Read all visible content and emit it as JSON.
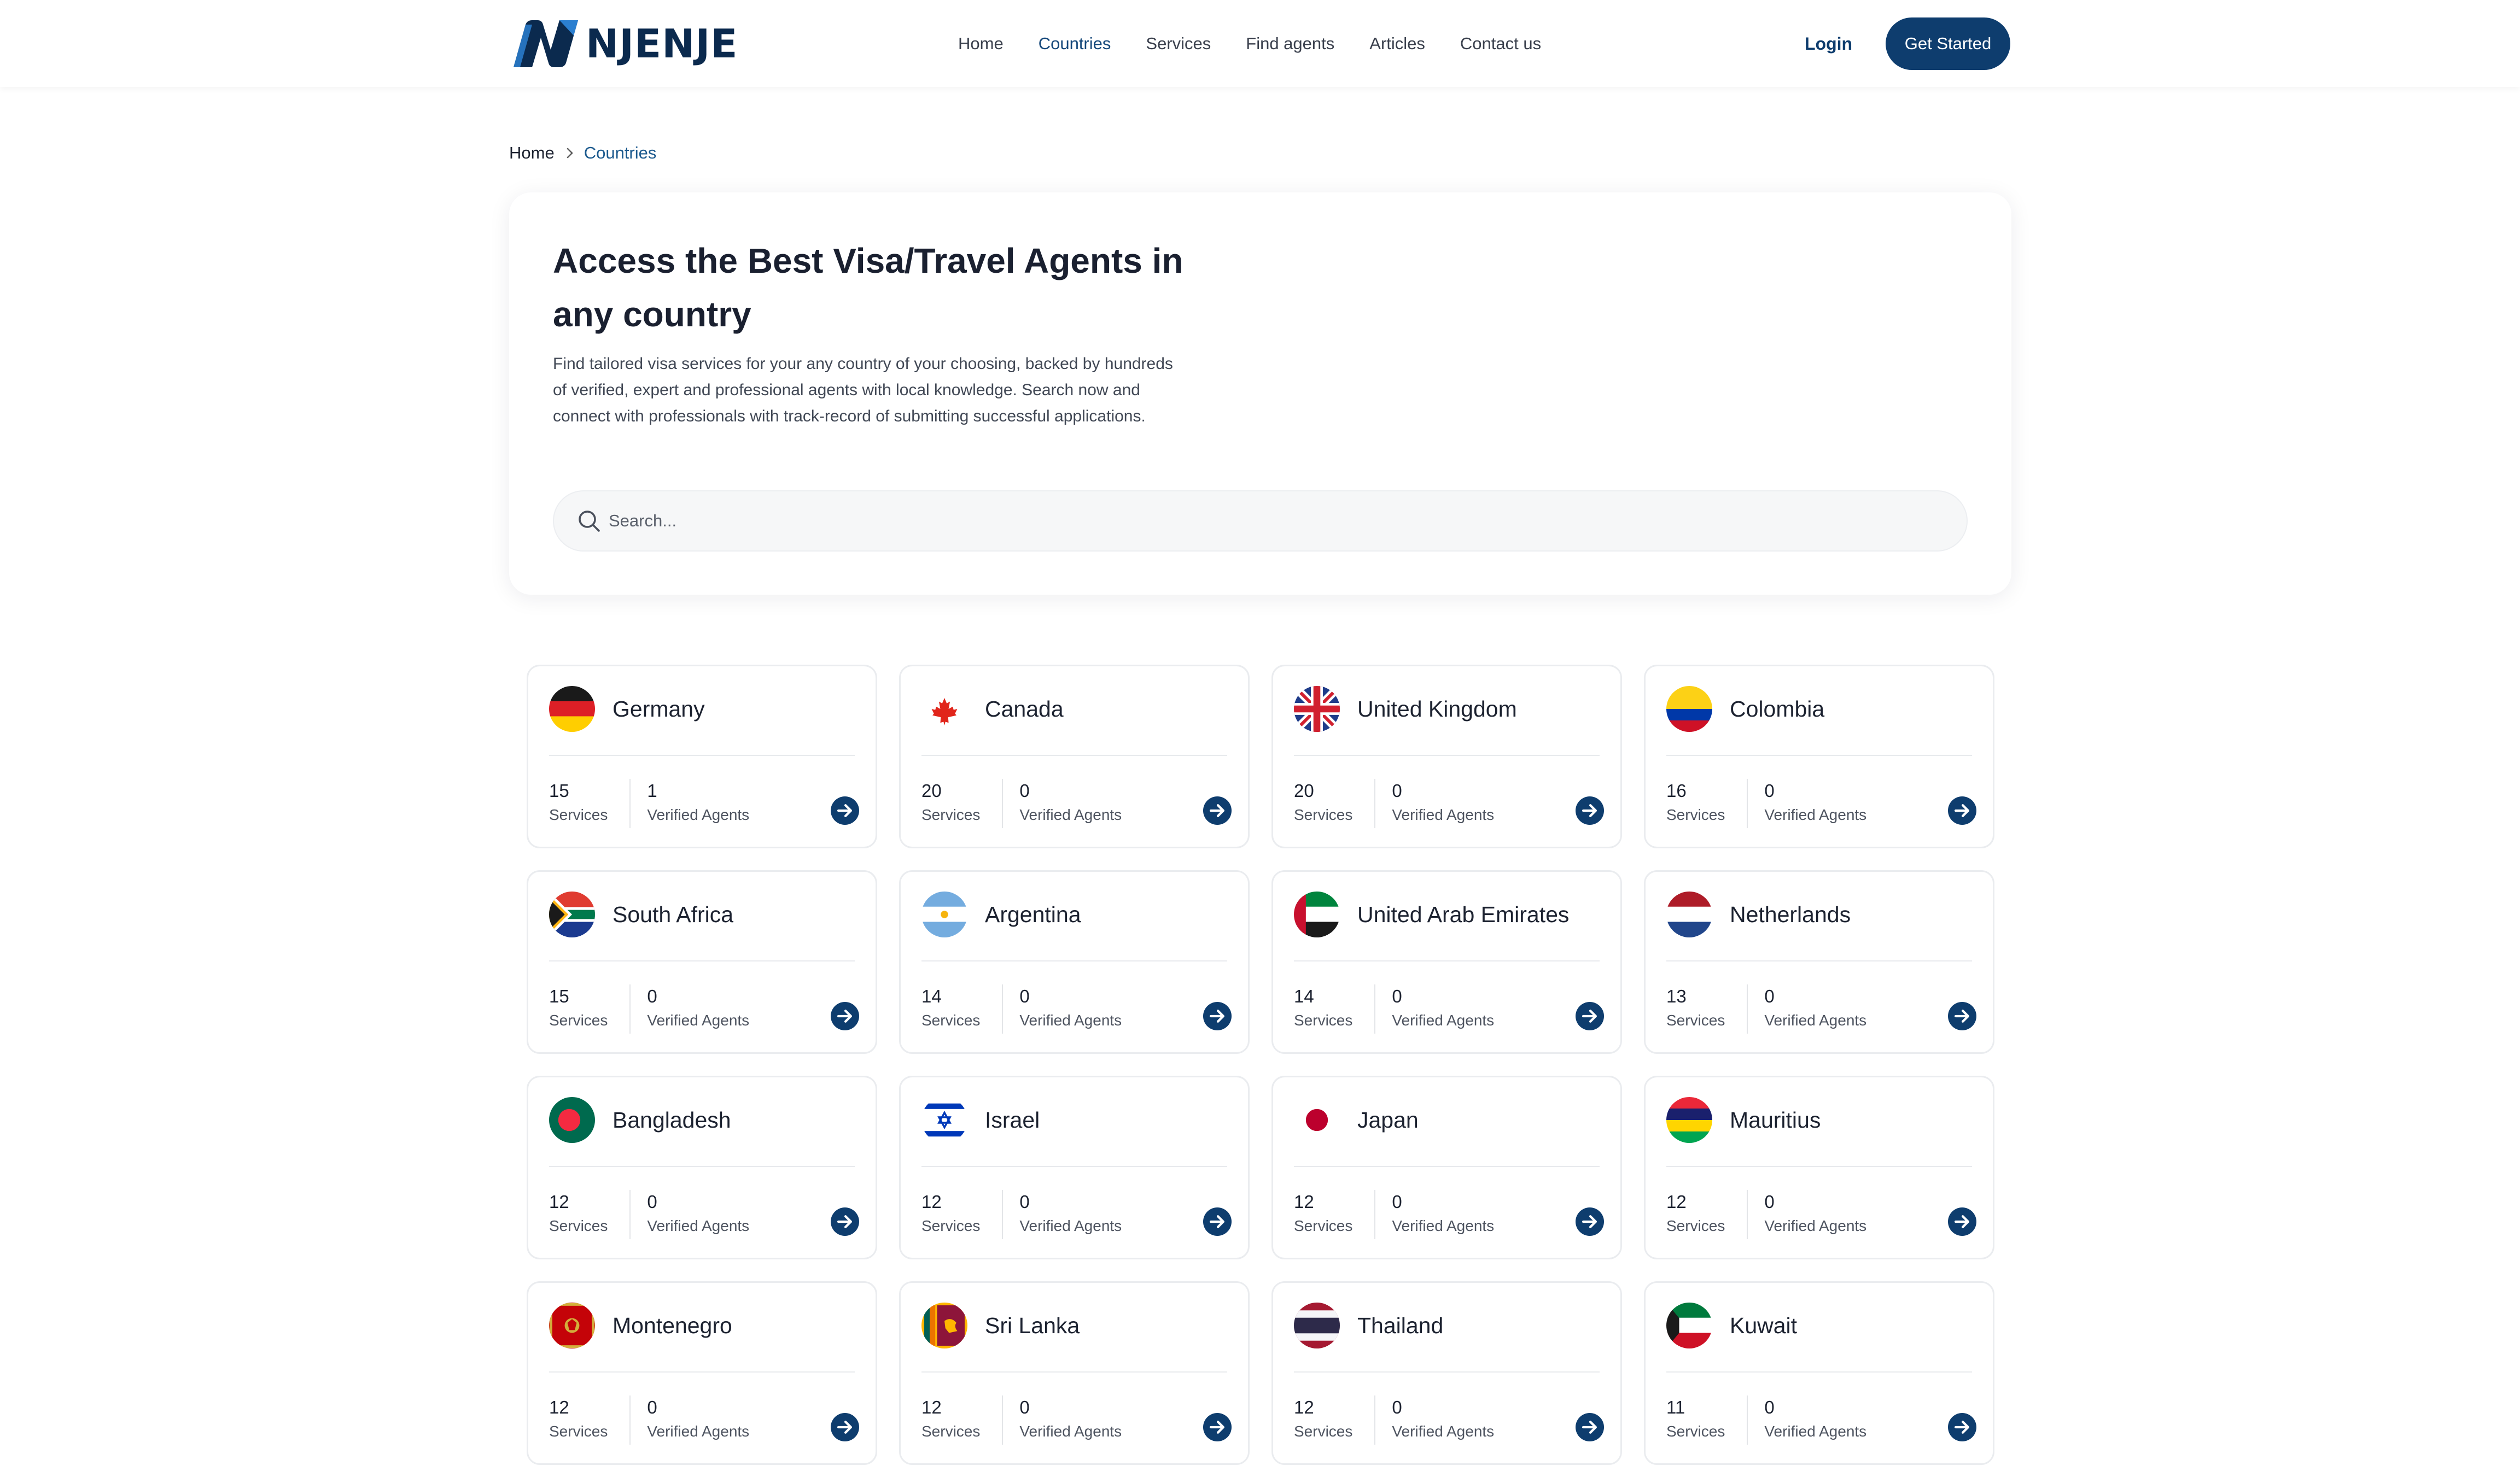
{
  "brand": {
    "name": "NJENJE"
  },
  "nav": {
    "links": [
      "Home",
      "Countries",
      "Services",
      "Find agents",
      "Articles",
      "Contact us"
    ],
    "active": "Countries",
    "login": "Login",
    "cta": "Get Started"
  },
  "breadcrumb": {
    "home": "Home",
    "current": "Countries"
  },
  "hero": {
    "title": "Access the Best Visa/Travel Agents in any country",
    "description": "Find tailored visa services for your any country of your choosing, backed by hundreds of verified, expert and professional agents with local knowledge. Search now and connect with professionals with track-record of submitting successful applications.",
    "search_placeholder": "Search..."
  },
  "labels": {
    "services": "Services",
    "agents": "Verified Agents"
  },
  "colors": {
    "primary": "#0e3d6e",
    "link_active": "#14477a",
    "text": "#1c2230"
  },
  "countries": [
    {
      "name": "Germany",
      "services": "15",
      "agents": "1",
      "flag": "germany-flag-icon"
    },
    {
      "name": "Canada",
      "services": "20",
      "agents": "0",
      "flag": "canada-flag-icon"
    },
    {
      "name": "United Kingdom",
      "services": "20",
      "agents": "0",
      "flag": "uk-flag-icon"
    },
    {
      "name": "Colombia",
      "services": "16",
      "agents": "0",
      "flag": "colombia-flag-icon"
    },
    {
      "name": "South Africa",
      "services": "15",
      "agents": "0",
      "flag": "south-africa-flag-icon"
    },
    {
      "name": "Argentina",
      "services": "14",
      "agents": "0",
      "flag": "argentina-flag-icon"
    },
    {
      "name": "United Arab Emirates",
      "services": "14",
      "agents": "0",
      "flag": "uae-flag-icon"
    },
    {
      "name": "Netherlands",
      "services": "13",
      "agents": "0",
      "flag": "netherlands-flag-icon"
    },
    {
      "name": "Bangladesh",
      "services": "12",
      "agents": "0",
      "flag": "bangladesh-flag-icon"
    },
    {
      "name": "Israel",
      "services": "12",
      "agents": "0",
      "flag": "israel-flag-icon"
    },
    {
      "name": "Japan",
      "services": "12",
      "agents": "0",
      "flag": "japan-flag-icon"
    },
    {
      "name": "Mauritius",
      "services": "12",
      "agents": "0",
      "flag": "mauritius-flag-icon"
    },
    {
      "name": "Montenegro",
      "services": "12",
      "agents": "0",
      "flag": "montenegro-flag-icon"
    },
    {
      "name": "Sri Lanka",
      "services": "12",
      "agents": "0",
      "flag": "sri-lanka-flag-icon"
    },
    {
      "name": "Thailand",
      "services": "12",
      "agents": "0",
      "flag": "thailand-flag-icon"
    },
    {
      "name": "Kuwait",
      "services": "11",
      "agents": "0",
      "flag": "kuwait-flag-icon"
    }
  ]
}
